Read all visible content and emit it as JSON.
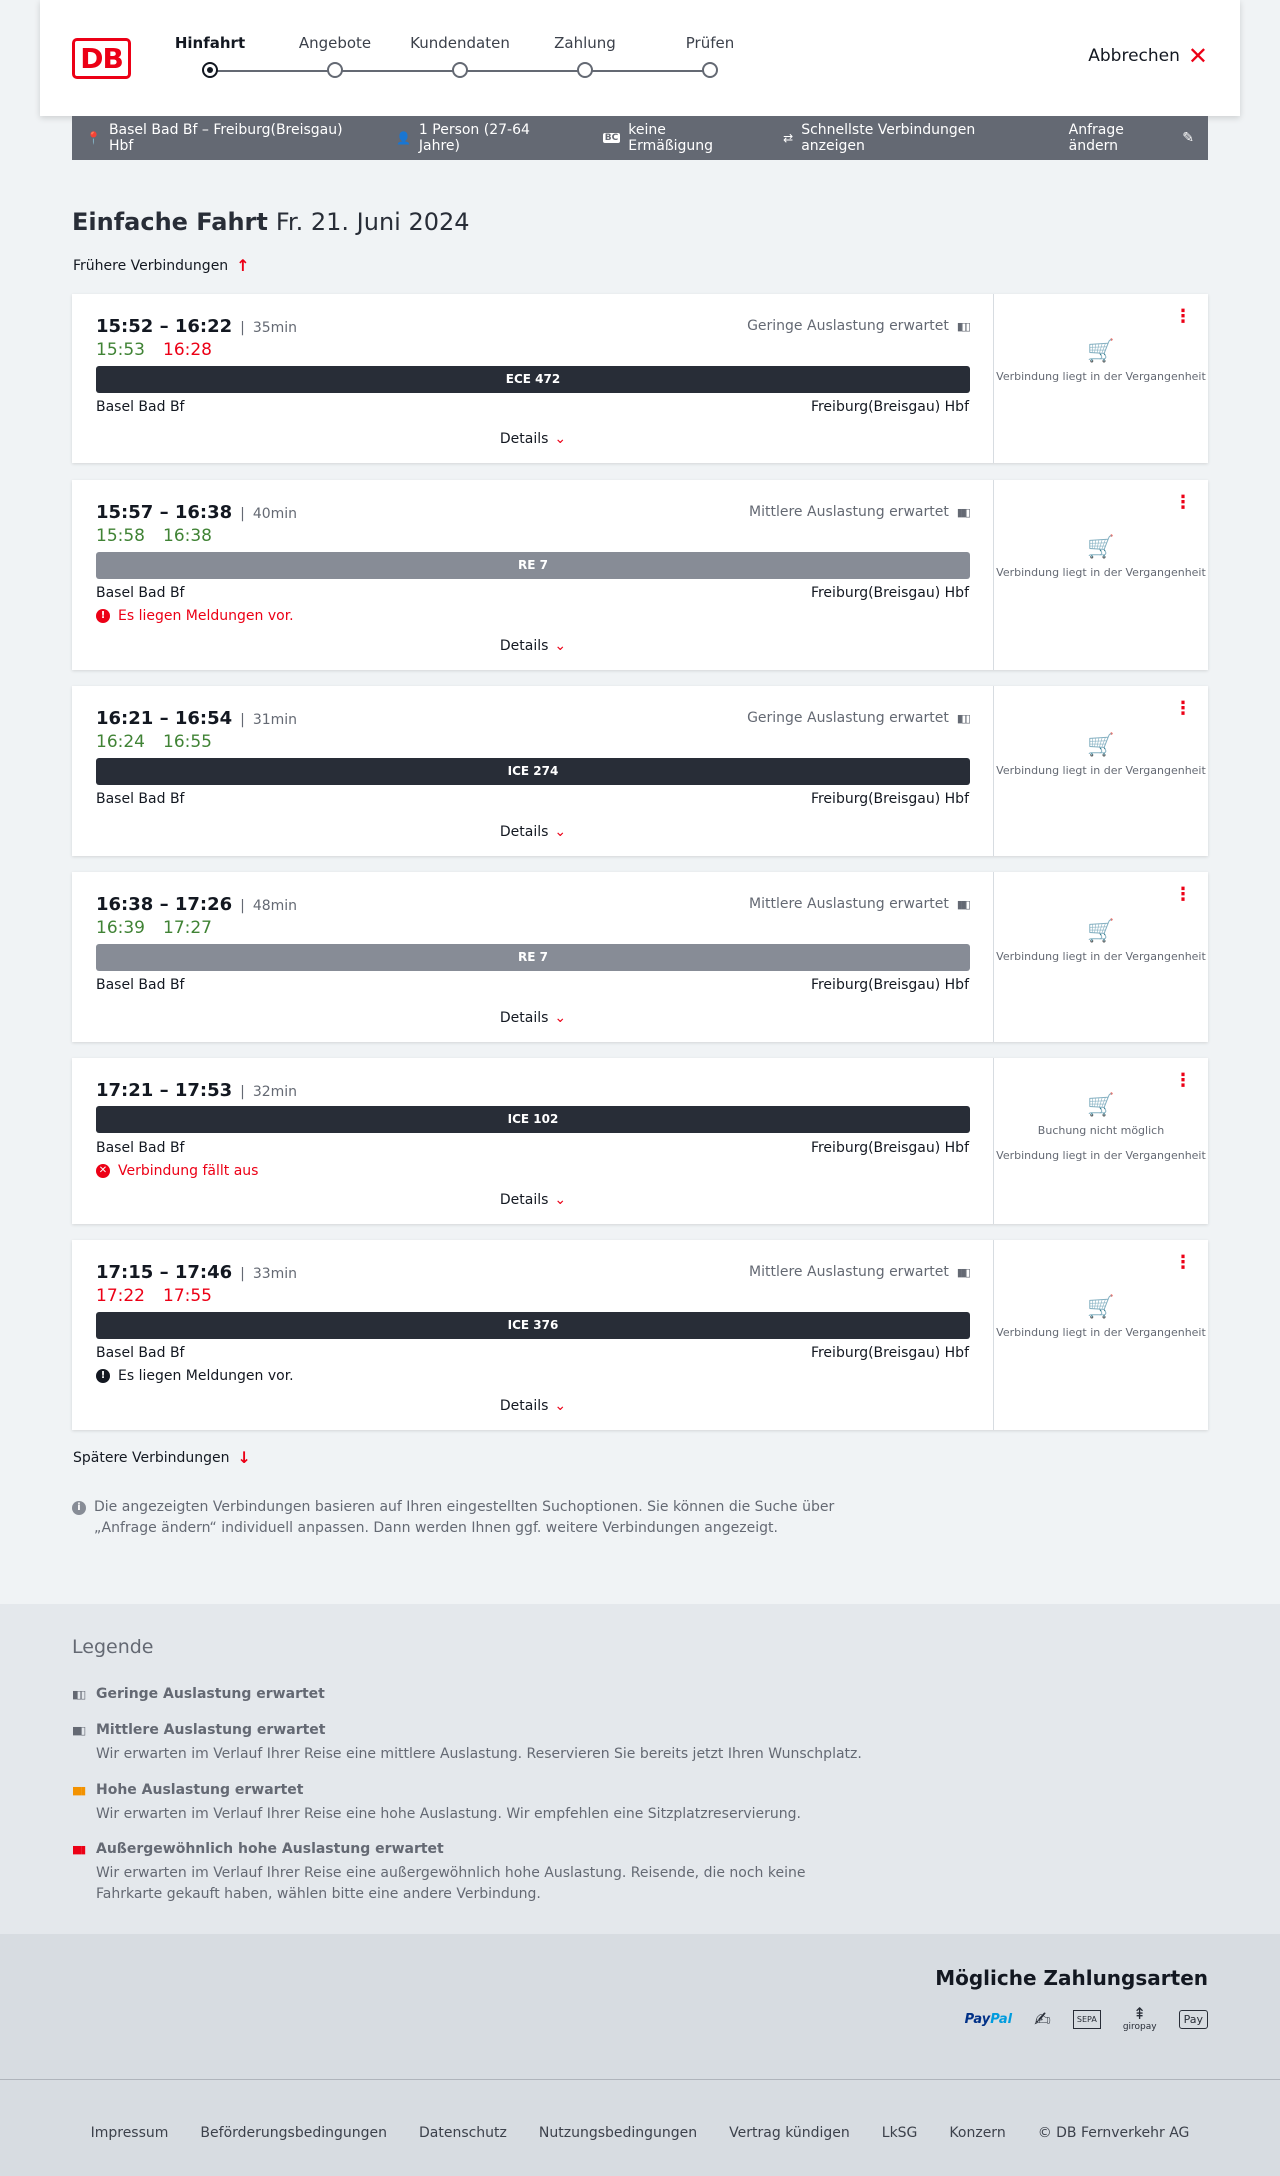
{
  "header": {
    "logo": "DB",
    "steps": [
      "Hinfahrt",
      "Angebote",
      "Kundendaten",
      "Zahlung",
      "Prüfen"
    ],
    "active_step": "Hinfahrt",
    "cancel_label": "Abbrechen"
  },
  "search": {
    "route": "Basel Bad Bf – Freiburg(Breisgau) Hbf",
    "passengers": "1 Person (27-64 Jahre)",
    "discount_badge": "BC",
    "discount": "keine Ermäßigung",
    "option": "Schnellste Verbindungen anzeigen",
    "change_label": "Anfrage ändern"
  },
  "trip": {
    "type": "Einfache Fahrt",
    "date": "Fr. 21. Juni 2024",
    "earlier": "Frühere Verbindungen",
    "later": "Spätere Verbindungen"
  },
  "connections": [
    {
      "times": "15:52 – 16:22",
      "duration": "35min",
      "rt_dep": "15:53",
      "rt_arr": "16:28",
      "rt_dep_color": "green",
      "rt_arr_color": "red",
      "load": "Geringe Auslastung erwartet",
      "train": "ECE 472",
      "train_style": "dark",
      "from": "Basel Bad Bf",
      "to": "Freiburg(Breisgau) Hbf",
      "message": "",
      "details": "Details",
      "side": "Verbindung liegt in der Vergangenheit",
      "side_extra": ""
    },
    {
      "times": "15:57 – 16:38",
      "duration": "40min",
      "rt_dep": "15:58",
      "rt_arr": "16:38",
      "rt_dep_color": "green",
      "rt_arr_color": "green",
      "load": "Mittlere Auslastung erwartet",
      "train": "RE 7",
      "train_style": "grey",
      "from": "Basel Bad Bf",
      "to": "Freiburg(Breisgau) Hbf",
      "message": "Es liegen Meldungen vor.",
      "message_style": "red",
      "details": "Details",
      "side": "Verbindung liegt in der Vergangenheit",
      "side_extra": ""
    },
    {
      "times": "16:21 – 16:54",
      "duration": "31min",
      "rt_dep": "16:24",
      "rt_arr": "16:55",
      "rt_dep_color": "green",
      "rt_arr_color": "green",
      "load": "Geringe Auslastung erwartet",
      "train": "ICE 274",
      "train_style": "dark",
      "from": "Basel Bad Bf",
      "to": "Freiburg(Breisgau) Hbf",
      "message": "",
      "details": "Details",
      "side": "Verbindung liegt in der Vergangenheit",
      "side_extra": ""
    },
    {
      "times": "16:38 – 17:26",
      "duration": "48min",
      "rt_dep": "16:39",
      "rt_arr": "17:27",
      "rt_dep_color": "green",
      "rt_arr_color": "green",
      "load": "Mittlere Auslastung erwartet",
      "train": "RE 7",
      "train_style": "grey",
      "from": "Basel Bad Bf",
      "to": "Freiburg(Breisgau) Hbf",
      "message": "",
      "details": "Details",
      "side": "Verbindung liegt in der Vergangenheit",
      "side_extra": ""
    },
    {
      "times": "17:21 – 17:53",
      "duration": "32min",
      "rt_dep": "",
      "rt_arr": "",
      "load": "",
      "train": "ICE 102",
      "train_style": "dark",
      "from": "Basel Bad Bf",
      "to": "Freiburg(Breisgau) Hbf",
      "message": "Verbindung fällt aus",
      "message_style": "red-x",
      "details": "Details",
      "side": "Verbindung liegt in der Vergangenheit",
      "side_extra": "Buchung nicht möglich"
    },
    {
      "times": "17:15 – 17:46",
      "duration": "33min",
      "rt_dep": "17:22",
      "rt_arr": "17:55",
      "rt_dep_color": "red",
      "rt_arr_color": "red",
      "load": "Mittlere Auslastung erwartet",
      "train": "ICE 376",
      "train_style": "dark",
      "from": "Basel Bad Bf",
      "to": "Freiburg(Breisgau) Hbf",
      "message": "Es liegen Meldungen vor.",
      "message_style": "black",
      "details": "Details",
      "side": "Verbindung liegt in der Vergangenheit",
      "side_extra": ""
    }
  ],
  "info_text": "Die angezeigten Verbindungen basieren auf Ihren eingestellten Suchoptionen. Sie können die Suche über „Anfrage ändern“ individuell anpassen. Dann werden Ihnen ggf. weitere Verbindungen angezeigt.",
  "legend": {
    "title": "Legende",
    "items": [
      {
        "title": "Geringe Auslastung erwartet",
        "text": "",
        "icon_color": "grey"
      },
      {
        "title": "Mittlere Auslastung erwartet",
        "text": "Wir erwarten im Verlauf Ihrer Reise eine mittlere Auslastung. Reservieren Sie bereits jetzt Ihren Wunschplatz.",
        "icon_color": "grey"
      },
      {
        "title": "Hohe Auslastung erwartet",
        "text": "Wir erwarten im Verlauf Ihrer Reise eine hohe Auslastung. Wir empfehlen eine Sitzplatzreservierung.",
        "icon_color": "orange"
      },
      {
        "title": "Außergewöhnlich hohe Auslastung erwartet",
        "text": "Wir erwarten im Verlauf Ihrer Reise eine außergewöhnlich hohe Auslastung. Reisende, die noch keine Fahrkarte gekauft haben, wählen bitte eine andere Verbindung.",
        "icon_color": "red"
      }
    ]
  },
  "payment": {
    "title": "Mögliche Zahlungsarten",
    "methods": [
      "PayPal",
      "Kreditkarte",
      "SEPA",
      "giropay",
      "Apple Pay"
    ],
    "paypal_a": "Pay",
    "paypal_b": "Pal",
    "sepa_label": "SEPA",
    "giropay_label": "giropay",
    "applepay_label": "Pay"
  },
  "footer": {
    "links": [
      "Impressum",
      "Beförderungsbedingungen",
      "Datenschutz",
      "Nutzungsbedingungen",
      "Vertrag kündigen",
      "LkSG",
      "Konzern",
      "© DB Fernverkehr AG"
    ]
  },
  "colors": {
    "accent": "#ec0016",
    "green": "#408335",
    "dark": "#282d37",
    "grey": "#878c96",
    "orange": "#f39200"
  }
}
